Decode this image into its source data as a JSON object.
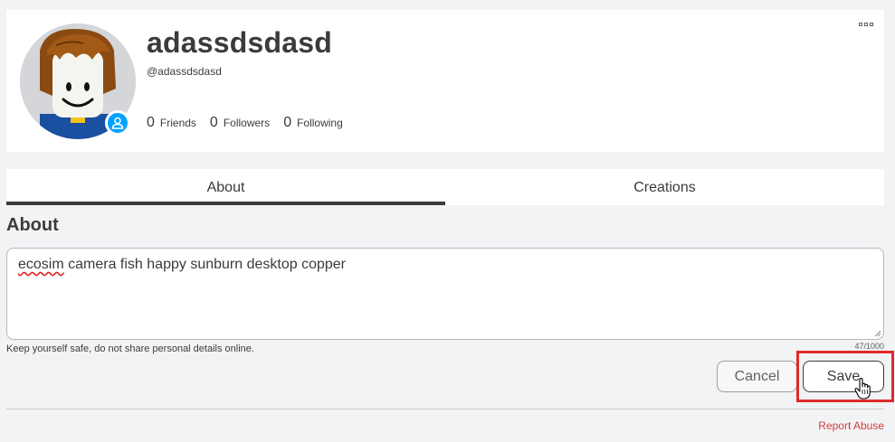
{
  "profile": {
    "display_name": "adassdsdasd",
    "username": "@adassdsdasd",
    "avatar_icon": "roblox-avatar",
    "presence_icon": "user-icon",
    "presence_color": "#00a2ff",
    "more_icon": "more-dots-icon",
    "stats": [
      {
        "count": "0",
        "label": "Friends"
      },
      {
        "count": "0",
        "label": "Followers"
      },
      {
        "count": "0",
        "label": "Following"
      }
    ]
  },
  "tabs": [
    {
      "label": "About",
      "active": true
    },
    {
      "label": "Creations",
      "active": false
    }
  ],
  "about": {
    "heading": "About",
    "text_first_word": "ecosim",
    "text_rest": " camera fish happy sunburn desktop copper",
    "safety_hint": "Keep yourself safe, do not share personal details online.",
    "char_count": "47/1000",
    "cancel_label": "Cancel",
    "save_label": "Save"
  },
  "footer": {
    "report_label": "Report Abuse",
    "report_color": "#d63c3c"
  },
  "annotation": {
    "highlight_color": "#e02a2a",
    "cursor_icon": "hand-pointer-icon"
  }
}
